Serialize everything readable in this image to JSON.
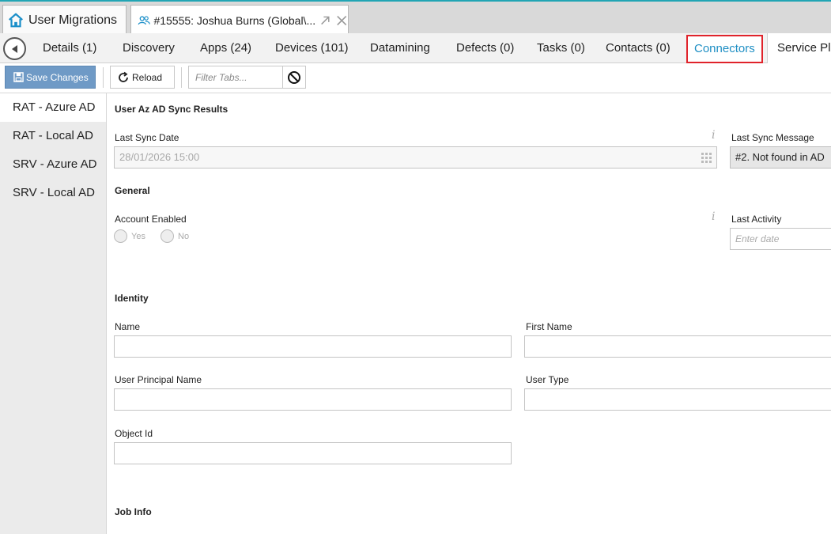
{
  "window_tabs": {
    "home_label": "User Migrations",
    "doc_label": "#15555: Joshua Burns (Global\\..."
  },
  "nav_tabs": [
    {
      "label": "Details (1)"
    },
    {
      "label": "Discovery"
    },
    {
      "label": "Apps (24)"
    },
    {
      "label": "Devices (101)"
    },
    {
      "label": "Datamining"
    },
    {
      "label": "Defects (0)"
    },
    {
      "label": "Tasks (0)"
    },
    {
      "label": "Contacts (0)"
    },
    {
      "label": "Connectors"
    },
    {
      "label": "Service Pla"
    }
  ],
  "toolbar": {
    "save_label": "Save Changes",
    "reload_label": "Reload",
    "filter_placeholder": "Filter Tabs..."
  },
  "sidebar": {
    "items": [
      {
        "label": "RAT - Azure AD"
      },
      {
        "label": "RAT - Local AD"
      },
      {
        "label": "SRV - Azure AD"
      },
      {
        "label": "SRV - Local AD"
      }
    ]
  },
  "main": {
    "sync_section": "User Az AD Sync Results",
    "last_sync_date_label": "Last Sync Date",
    "last_sync_date_value": "28/01/2026 15:00",
    "last_sync_message_label": "Last Sync Message",
    "last_sync_message_value": "#2. Not found in AD",
    "general_section": "General",
    "account_enabled_label": "Account Enabled",
    "yes_label": "Yes",
    "no_label": "No",
    "last_activity_label": "Last Activity",
    "last_activity_placeholder": "Enter date",
    "identity_section": "Identity",
    "name_label": "Name",
    "first_name_label": "First Name",
    "upn_label": "User Principal Name",
    "user_type_label": "User Type",
    "object_id_label": "Object Id",
    "job_info_section": "Job Info",
    "info_glyph": "i"
  },
  "colors": {
    "accent_border": "#22a5b4",
    "active_tab_text": "#1f8fc4",
    "active_tab_outline": "#e0232b",
    "save_button": "#6f9ac6"
  }
}
